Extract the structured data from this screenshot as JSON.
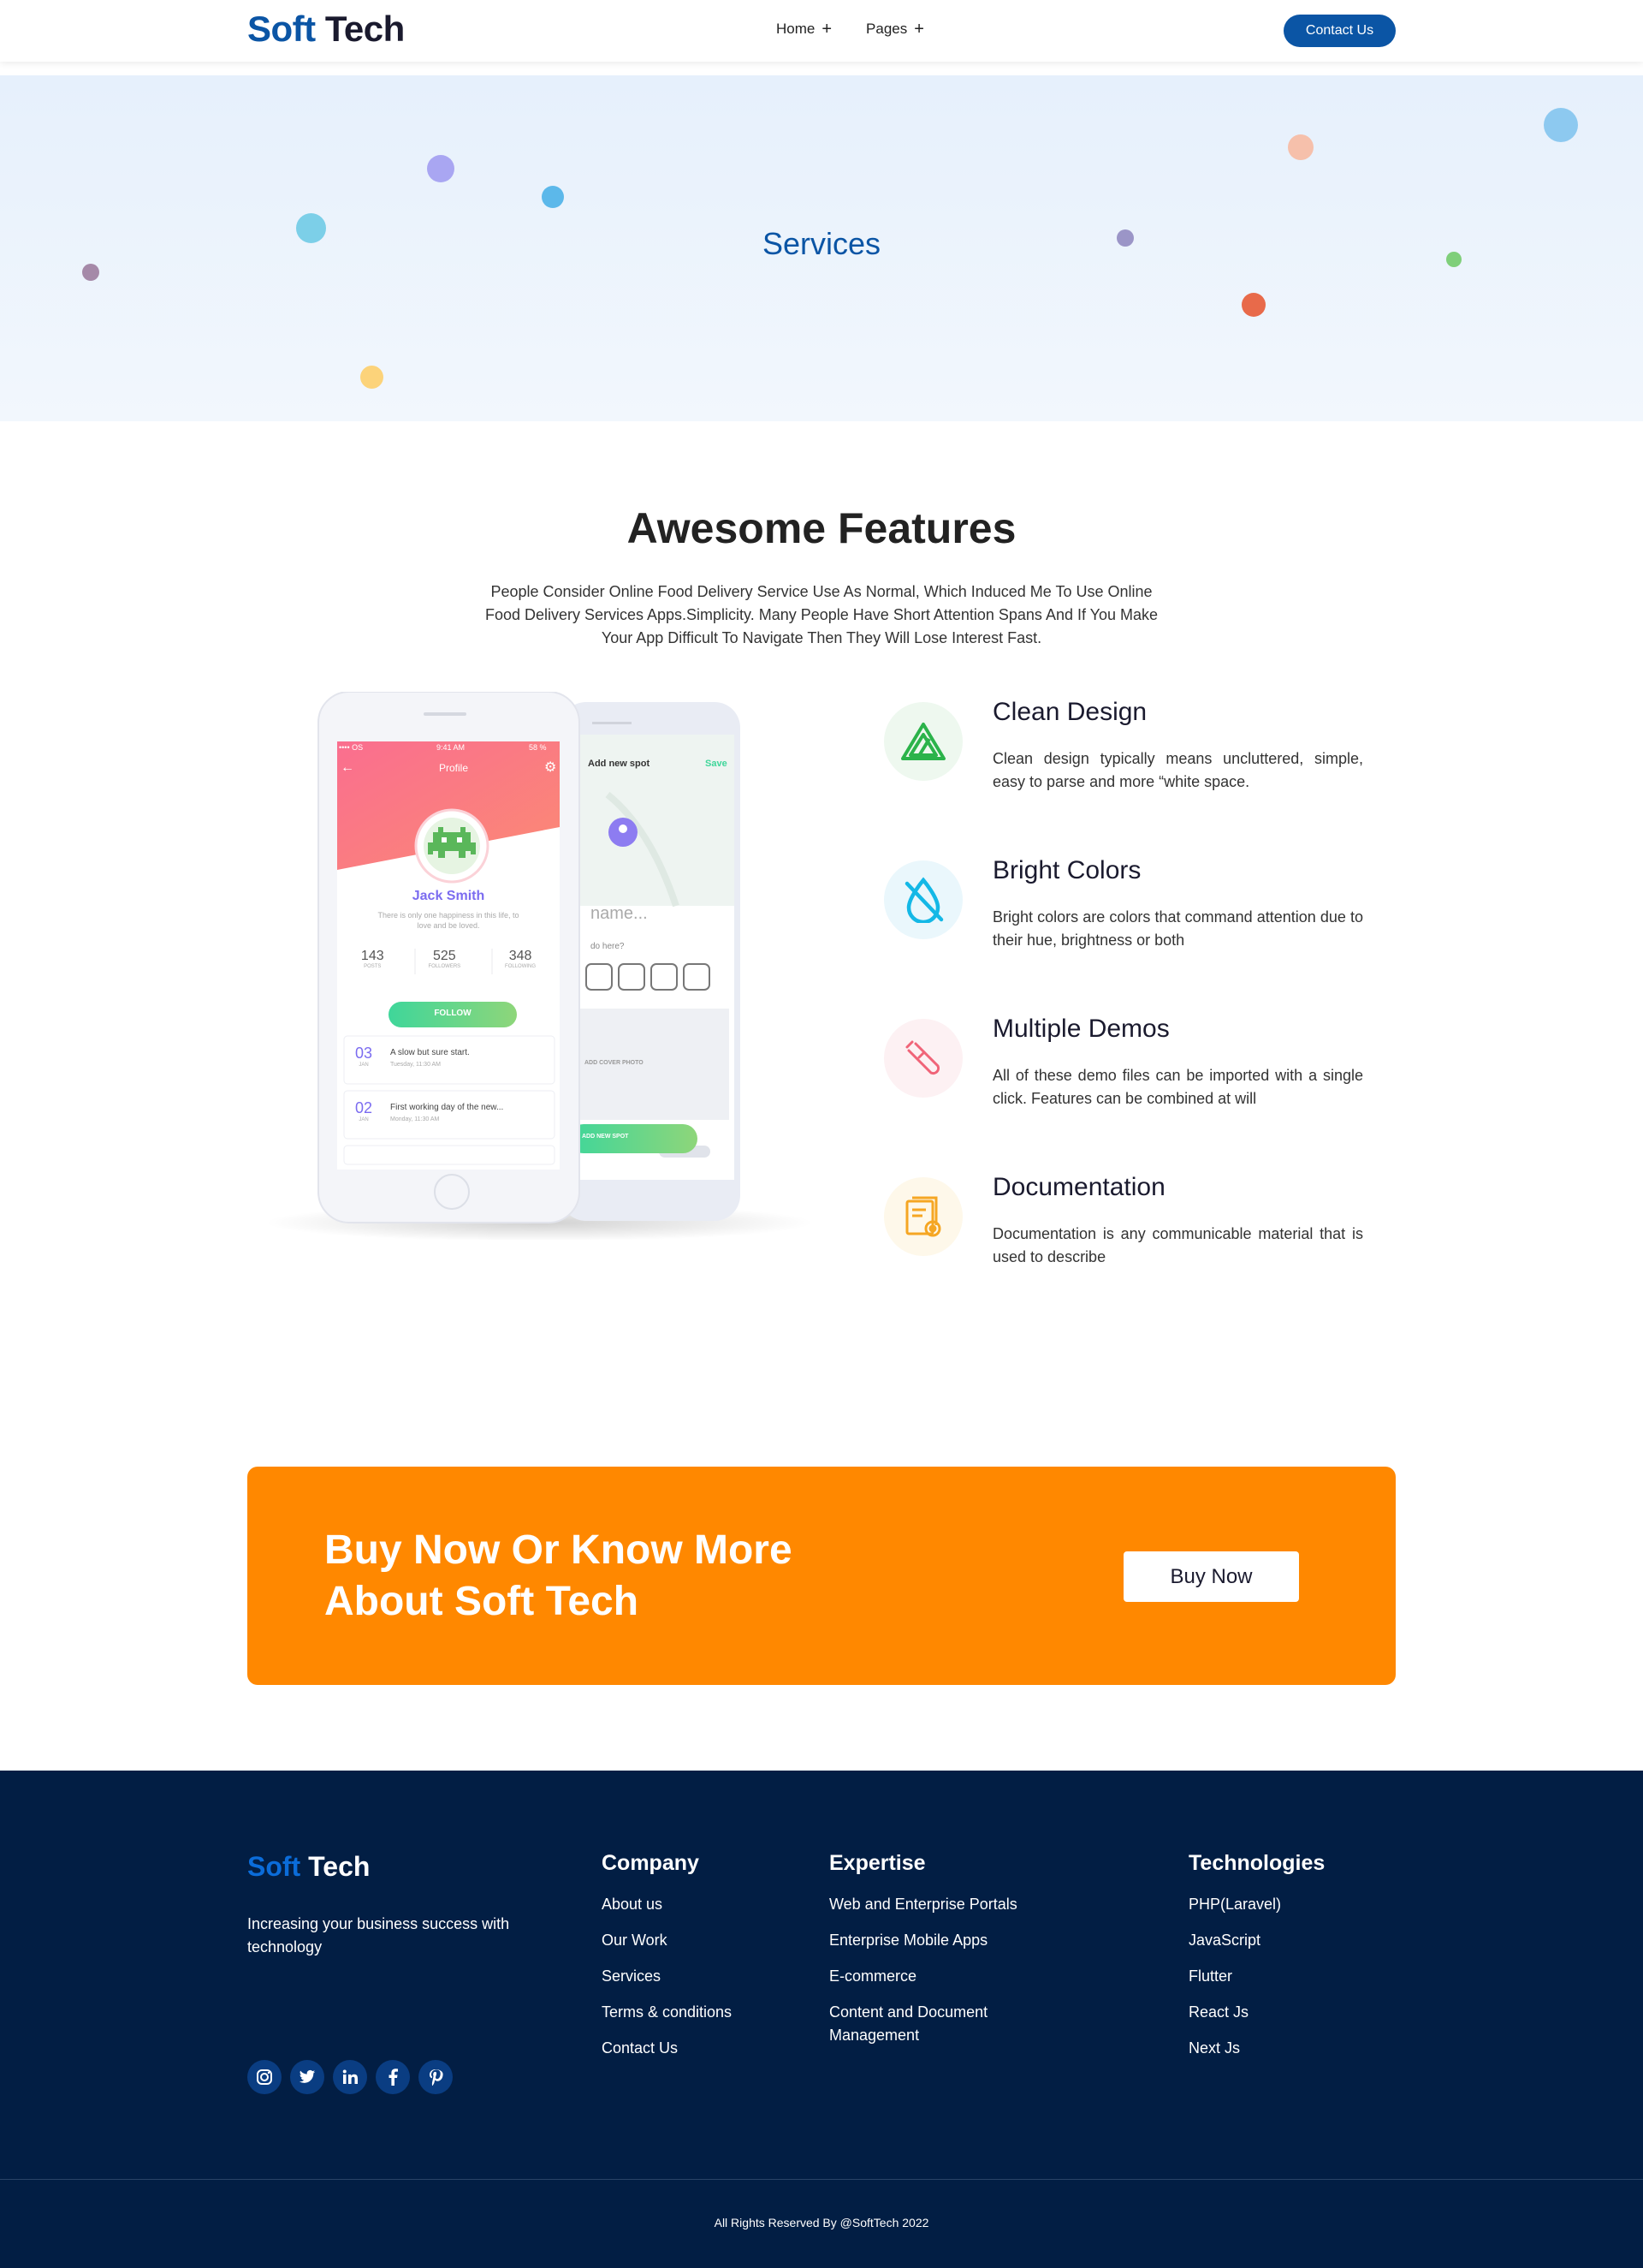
{
  "header": {
    "logo_a": "Soft",
    "logo_b": "Tech",
    "nav": [
      {
        "label": "Home"
      },
      {
        "label": "Pages"
      }
    ],
    "contact_label": "Contact Us"
  },
  "banner": {
    "title": "Services"
  },
  "features": {
    "title": "Awesome Features",
    "description": "People Consider Online Food Delivery Service Use As Normal, Which Induced Me To Use Online Food Delivery Services Apps.Simplicity. Many People Have Short Attention Spans And If You Make Your App Difficult To Navigate Then They Will Lose Interest Fast.",
    "items": [
      {
        "name": "Clean Design",
        "text": "Clean design typically means uncluttered, simple, easy to parse and more “white space.",
        "icon": "triangle-logo-icon",
        "color": "#2bb34a"
      },
      {
        "name": "Bright Colors",
        "text": "Bright colors are colors that command attention due to their hue, brightness or both",
        "icon": "color-drop-icon",
        "color": "#14b8e6"
      },
      {
        "name": "Multiple Demos",
        "text": "All of these demo files can be imported with a single click. Features can be combined at will",
        "icon": "test-tube-icon",
        "color": "#f06478"
      },
      {
        "name": "Documentation",
        "text": "Documentation is any communicable material that is used to describe",
        "icon": "document-gear-icon",
        "color": "#f5a623"
      }
    ]
  },
  "phone": {
    "time": "9:41 AM",
    "battery": "58 %",
    "signal": "•••• OS",
    "profile_title": "Profile",
    "name": "Jack Smith",
    "bio": "There is only one happiness in this life, to love and be loved.",
    "stats": [
      {
        "value": "143",
        "label": "POSTS"
      },
      {
        "value": "525",
        "label": "FOLLOWERS"
      },
      {
        "value": "348",
        "label": "FOLLOWING"
      }
    ],
    "follow_label": "FOLLOW",
    "posts": [
      {
        "day": "03",
        "month": "JAN",
        "title": "A slow but sure start.",
        "time": "Tuesday, 11:30 AM"
      },
      {
        "day": "02",
        "month": "JAN",
        "title": "First working day of the new...",
        "time": "Monday, 11:30 AM"
      }
    ],
    "back_title": "Add new spot",
    "back_save": "Save",
    "back_name": "name...",
    "back_question": "do here?",
    "back_cover": "ADD COVER PHOTO",
    "back_btn": "ADD NEW SPOT"
  },
  "cta": {
    "title": "Buy Now Or Know More About Soft Tech",
    "button": "Buy Now"
  },
  "footer": {
    "logo_a": "Soft",
    "logo_b": "Tech",
    "tagline": "Increasing your business success with technology",
    "columns": [
      {
        "title": "Company",
        "links": [
          "About us",
          "Our Work",
          "Services",
          "Terms & conditions",
          "Contact Us"
        ]
      },
      {
        "title": "Expertise",
        "links": [
          "Web and Enterprise Portals",
          "Enterprise Mobile Apps",
          "E-commerce",
          "Content and Document Management"
        ]
      },
      {
        "title": "Technologies",
        "links": [
          "PHP(Laravel)",
          "JavaScript",
          "Flutter",
          "React Js",
          "Next Js"
        ]
      }
    ],
    "socials": [
      "instagram-icon",
      "twitter-icon",
      "linkedin-icon",
      "facebook-icon",
      "pinterest-icon"
    ],
    "copyright": "All Rights Reserved By @SoftTech 2022"
  }
}
